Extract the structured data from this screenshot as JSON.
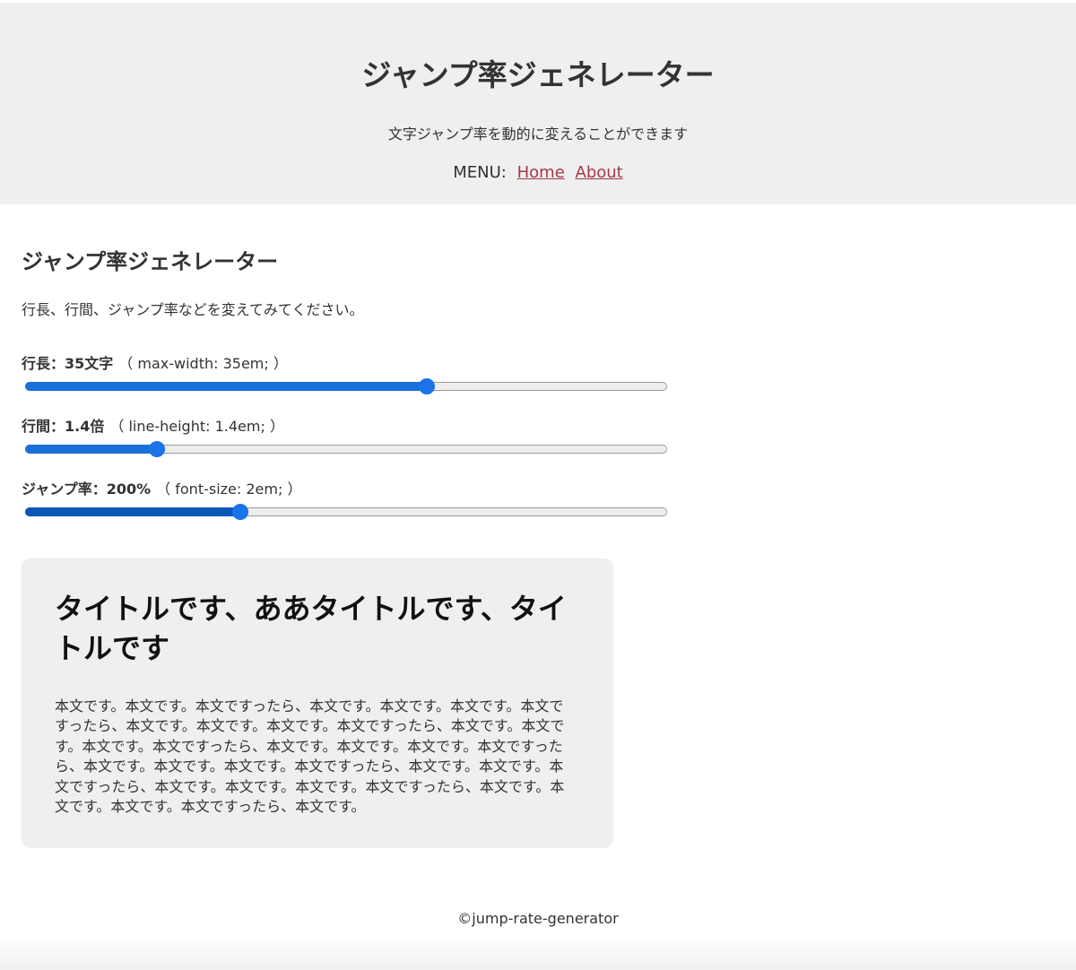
{
  "header": {
    "title": "ジャンプ率ジェネレーター",
    "subtitle": "文字ジャンプ率を動的に変えることができます",
    "menu_label": "MENU:",
    "menu_items": [
      {
        "label": "Home"
      },
      {
        "label": "About"
      }
    ]
  },
  "main": {
    "heading": "ジャンプ率ジェネレーター",
    "intro": "行長、行間、ジャンプ率などを変えてみてください。",
    "controls": [
      {
        "name": "行長：",
        "value": "35文字",
        "code": "（ max-width: 35em; ）",
        "level": 0.625
      },
      {
        "name": "行間：",
        "value": "1.4倍",
        "code": "（ line-height: 1.4em; ）",
        "level": 0.205
      },
      {
        "name": "ジャンプ率：",
        "value": "200%",
        "code": "（ font-size: 2em; ）",
        "level": 0.335
      }
    ]
  },
  "preview": {
    "title": "タイトルです、ああタイトルです、タイトルです",
    "body": "本文です。本文です。本文ですったら、本文です。本文です。本文です。本文ですったら、本文です。本文です。本文です。本文ですったら、本文です。本文です。本文です。本文ですったら、本文です。本文です。本文です。本文ですったら、本文です。本文です。本文です。本文ですったら、本文です。本文です。本文ですったら、本文です。本文です。本文です。本文ですったら、本文です。本文です。本文です。本文ですったら、本文です。"
  },
  "footer": {
    "copyright": "©jump-rate-generator"
  },
  "colors": {
    "header_bg": "#efefef",
    "link": "#a33a48",
    "slider_fill": "#1a6fd8",
    "preview_bg": "#efefef"
  }
}
